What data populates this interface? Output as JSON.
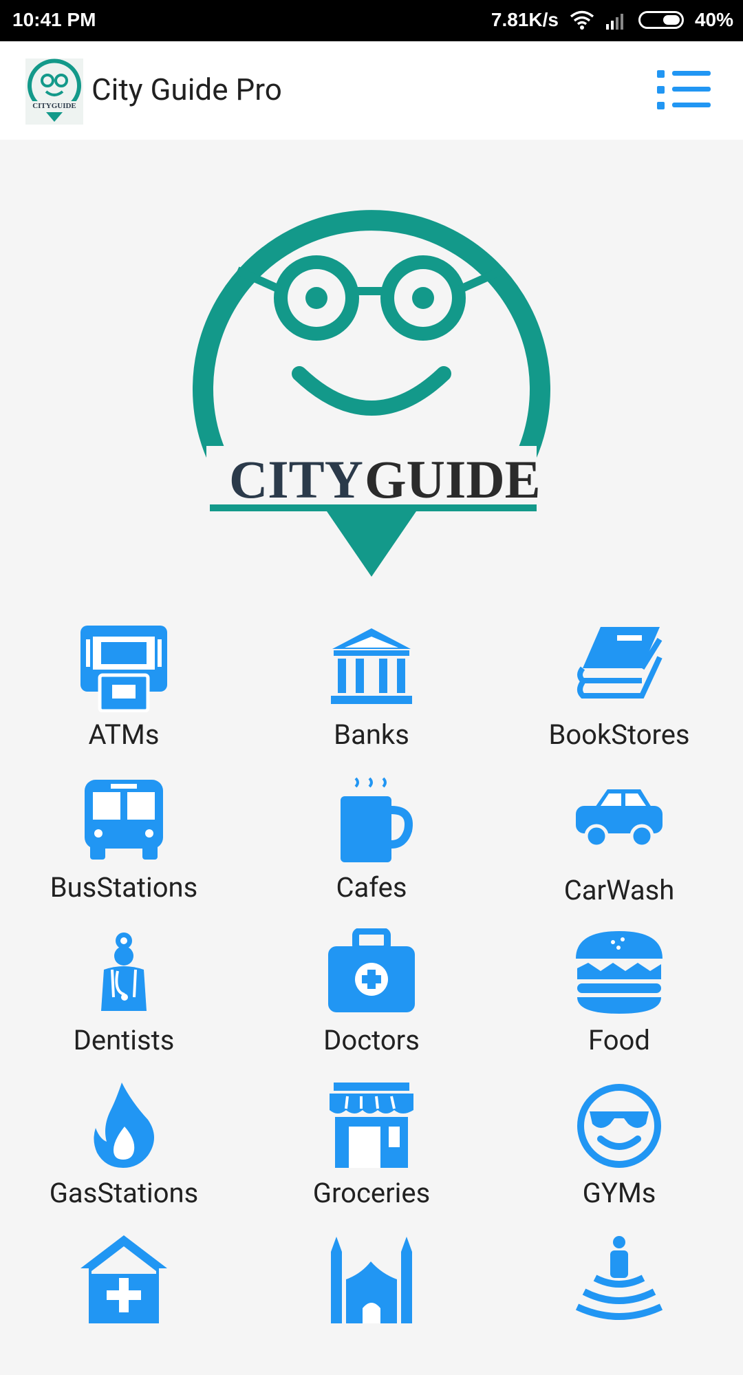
{
  "status_bar": {
    "time": "10:41 PM",
    "network_speed": "7.81K/s",
    "battery": "40%"
  },
  "app_bar": {
    "title": "City Guide Pro",
    "menu_icon": "list-menu-icon"
  },
  "hero": {
    "logo_text_dark": "CITY",
    "logo_text_light": "GUIDE"
  },
  "colors": {
    "accent_blue": "#2196F3",
    "brand_teal": "#13998a",
    "logo_dark": "#2b3a4a"
  },
  "categories": [
    {
      "label": "ATMs",
      "icon": "atm-icon"
    },
    {
      "label": "Banks",
      "icon": "bank-icon"
    },
    {
      "label": "BookStores",
      "icon": "books-icon"
    },
    {
      "label": "BusStations",
      "icon": "bus-icon"
    },
    {
      "label": "Cafes",
      "icon": "coffee-mug-icon"
    },
    {
      "label": "CarWash",
      "icon": "car-icon"
    },
    {
      "label": "Dentists",
      "icon": "doctor-icon"
    },
    {
      "label": "Doctors",
      "icon": "medical-kit-icon"
    },
    {
      "label": "Food",
      "icon": "burger-icon"
    },
    {
      "label": "GasStations",
      "icon": "flame-icon"
    },
    {
      "label": "Groceries",
      "icon": "store-icon"
    },
    {
      "label": "GYMs",
      "icon": "cool-face-icon"
    },
    {
      "label": "",
      "icon": "hospital-icon"
    },
    {
      "label": "",
      "icon": "mosque-icon"
    },
    {
      "label": "",
      "icon": "spa-icon"
    }
  ]
}
